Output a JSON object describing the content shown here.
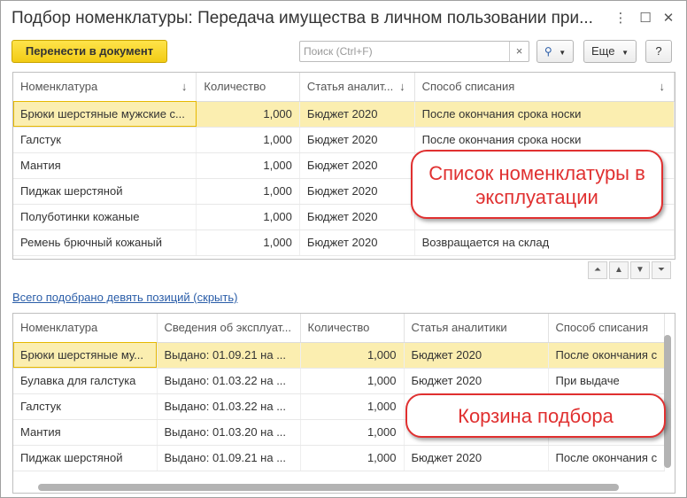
{
  "window": {
    "title": "Подбор номенклатуры: Передача имущества в личном пользовании при...",
    "more_icon": "more-vertical-icon",
    "maximize_icon": "maximize-icon",
    "close_icon": "close-icon"
  },
  "toolbar": {
    "transfer_label": "Перенести в документ",
    "search_placeholder": "Поиск (Ctrl+F)",
    "search_clear": "×",
    "search_icon": "🔍",
    "more_label": "Еще",
    "help_label": "?"
  },
  "top_table": {
    "columns": [
      "Номенклатура",
      "Количество",
      "Статья аналит...",
      "Способ списания"
    ],
    "rows": [
      [
        "Брюки шерстяные мужские с...",
        "1,000",
        "Бюджет 2020",
        "После окончания срока носки"
      ],
      [
        "Галстук",
        "1,000",
        "Бюджет 2020",
        "После окончания срока носки"
      ],
      [
        "Мантия",
        "1,000",
        "Бюджет 2020",
        ""
      ],
      [
        "Пиджак шерстяной",
        "1,000",
        "Бюджет 2020",
        ""
      ],
      [
        "Полуботинки кожаные",
        "1,000",
        "Бюджет 2020",
        ""
      ],
      [
        "Ремень брючный кожаный",
        "1,000",
        "Бюджет 2020",
        "Возвращается на склад"
      ]
    ]
  },
  "callout_top": "Список номенклатуры в эксплуатации",
  "selected_link": "Всего подобрано девять позиций (скрыть)",
  "bottom_table": {
    "columns": [
      "Номенклатура",
      "Сведения об эксплуат...",
      "Количество",
      "Статья аналитики",
      "Способ списания"
    ],
    "rows": [
      [
        "Брюки шерстяные му...",
        "Выдано: 01.09.21 на ...",
        "1,000",
        "Бюджет 2020",
        "После окончания с"
      ],
      [
        "Булавка для галстука",
        "Выдано: 01.03.22 на ...",
        "1,000",
        "Бюджет 2020",
        "При выдаче"
      ],
      [
        "Галстук",
        "Выдано: 01.03.22 на ...",
        "1,000",
        "",
        ""
      ],
      [
        "Мантия",
        "Выдано: 01.03.20 на ...",
        "1,000",
        "",
        ""
      ],
      [
        "Пиджак шерстяной",
        "Выдано: 01.09.21 на ...",
        "1,000",
        "Бюджет 2020",
        "После окончания с"
      ]
    ]
  },
  "callout_bottom": "Корзина подбора",
  "colors": {
    "primary_button": "#f2cc15",
    "selected_row": "#fbeeb0",
    "callout": "#e03030",
    "link": "#2a5da8"
  }
}
